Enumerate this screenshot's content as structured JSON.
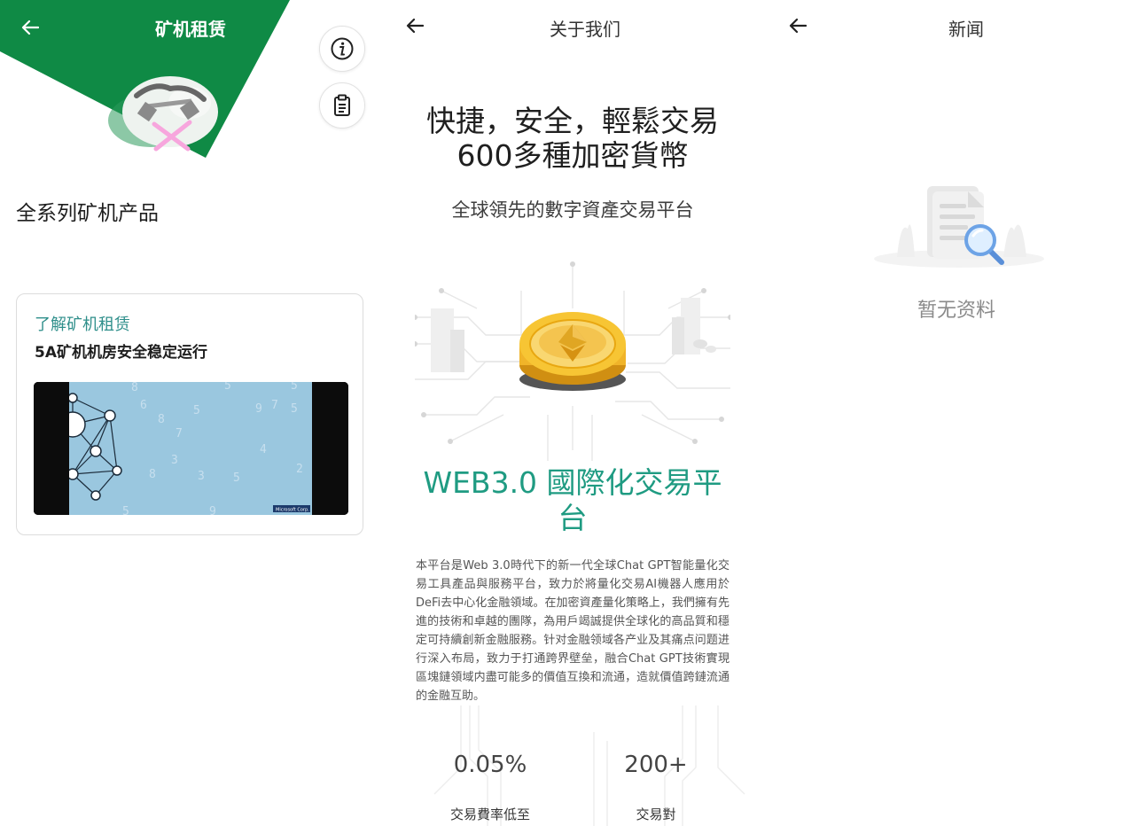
{
  "mining": {
    "title": "矿机租赁",
    "heading": "全系列矿机产品",
    "card": {
      "link": "了解矿机租赁",
      "subtitle": "5A矿机机房安全稳定运行",
      "video_badge": "Microsoft Corp."
    },
    "icons": [
      "back-arrow-icon",
      "info-icon",
      "clipboard-icon",
      "pickaxe-mascot-icon"
    ],
    "colors": {
      "brand_green": "#0f8a45",
      "link_teal": "#2f8f8b"
    }
  },
  "about": {
    "title": "关于我们",
    "hero_line1": "快捷，安全，輕鬆交易",
    "hero_line2": "600多種加密貨幣",
    "slogan": "全球領先的數字資產交易平台",
    "web3_title": "WEB3.0 國際化交易平台",
    "description": "本平台是Web 3.0時代下的新一代全球Chat GPT智能量化交易工具產品與服務平台，致力於將量化交易AI機器人應用於DeFi去中心化金融領域。在加密資產量化策略上，我們擁有先進的技術和卓越的團隊，為用戶竭誠提供全球化的高品質和穩定可持續創新金融服務。针对金融领域各产业及其痛点问题进行深入布局，致力于打通跨界壁垒，融合Chat GPT技術實現區塊鏈領域内盡可能多的價值互換和流通，造就價值跨鏈流通的金融互助。",
    "stats": [
      {
        "value": "0.05%",
        "label": "交易費率低至"
      },
      {
        "value": "200+",
        "label": "交易對"
      }
    ],
    "colors": {
      "accent_green": "#1f9b82",
      "coin_gold": "#f0b429"
    }
  },
  "news": {
    "title": "新闻",
    "empty_text": "暂无资料"
  }
}
